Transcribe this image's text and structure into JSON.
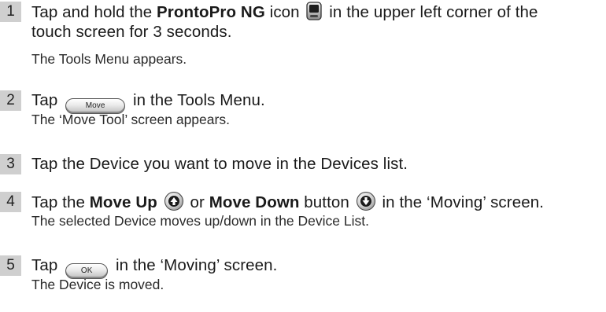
{
  "steps": [
    {
      "number": "1",
      "text_before": "Tap and hold the ",
      "bold": "ProntoPro NG",
      "text_middle": " icon",
      "text_after": " in the upper left corner of the",
      "text_line2": "touch screen for 3 seconds.",
      "result": "The Tools Menu appears."
    },
    {
      "number": "2",
      "text_before": "Tap",
      "button_label": "Move",
      "text_after": "in the Tools Menu.",
      "result": "The ‘Move Tool’ screen appears."
    },
    {
      "number": "3",
      "text": "Tap the Device you want to move in the Devices list."
    },
    {
      "number": "4",
      "text_before": "Tap the ",
      "bold1": "Move Up",
      "text_mid": " or ",
      "bold2": "Move Down",
      "text_mid2": " button",
      "text_after": " in the ‘Moving’ screen.",
      "result": "The selected Device moves up/down in the Device List."
    },
    {
      "number": "5",
      "text_before": "Tap",
      "button_label": "OK",
      "text_after": "in the ‘Moving’ screen.",
      "result": "The Device is moved."
    }
  ],
  "icons": {
    "pronto": "pronto-device-icon",
    "move_up": "move-up-icon",
    "move_down": "move-down-icon"
  }
}
